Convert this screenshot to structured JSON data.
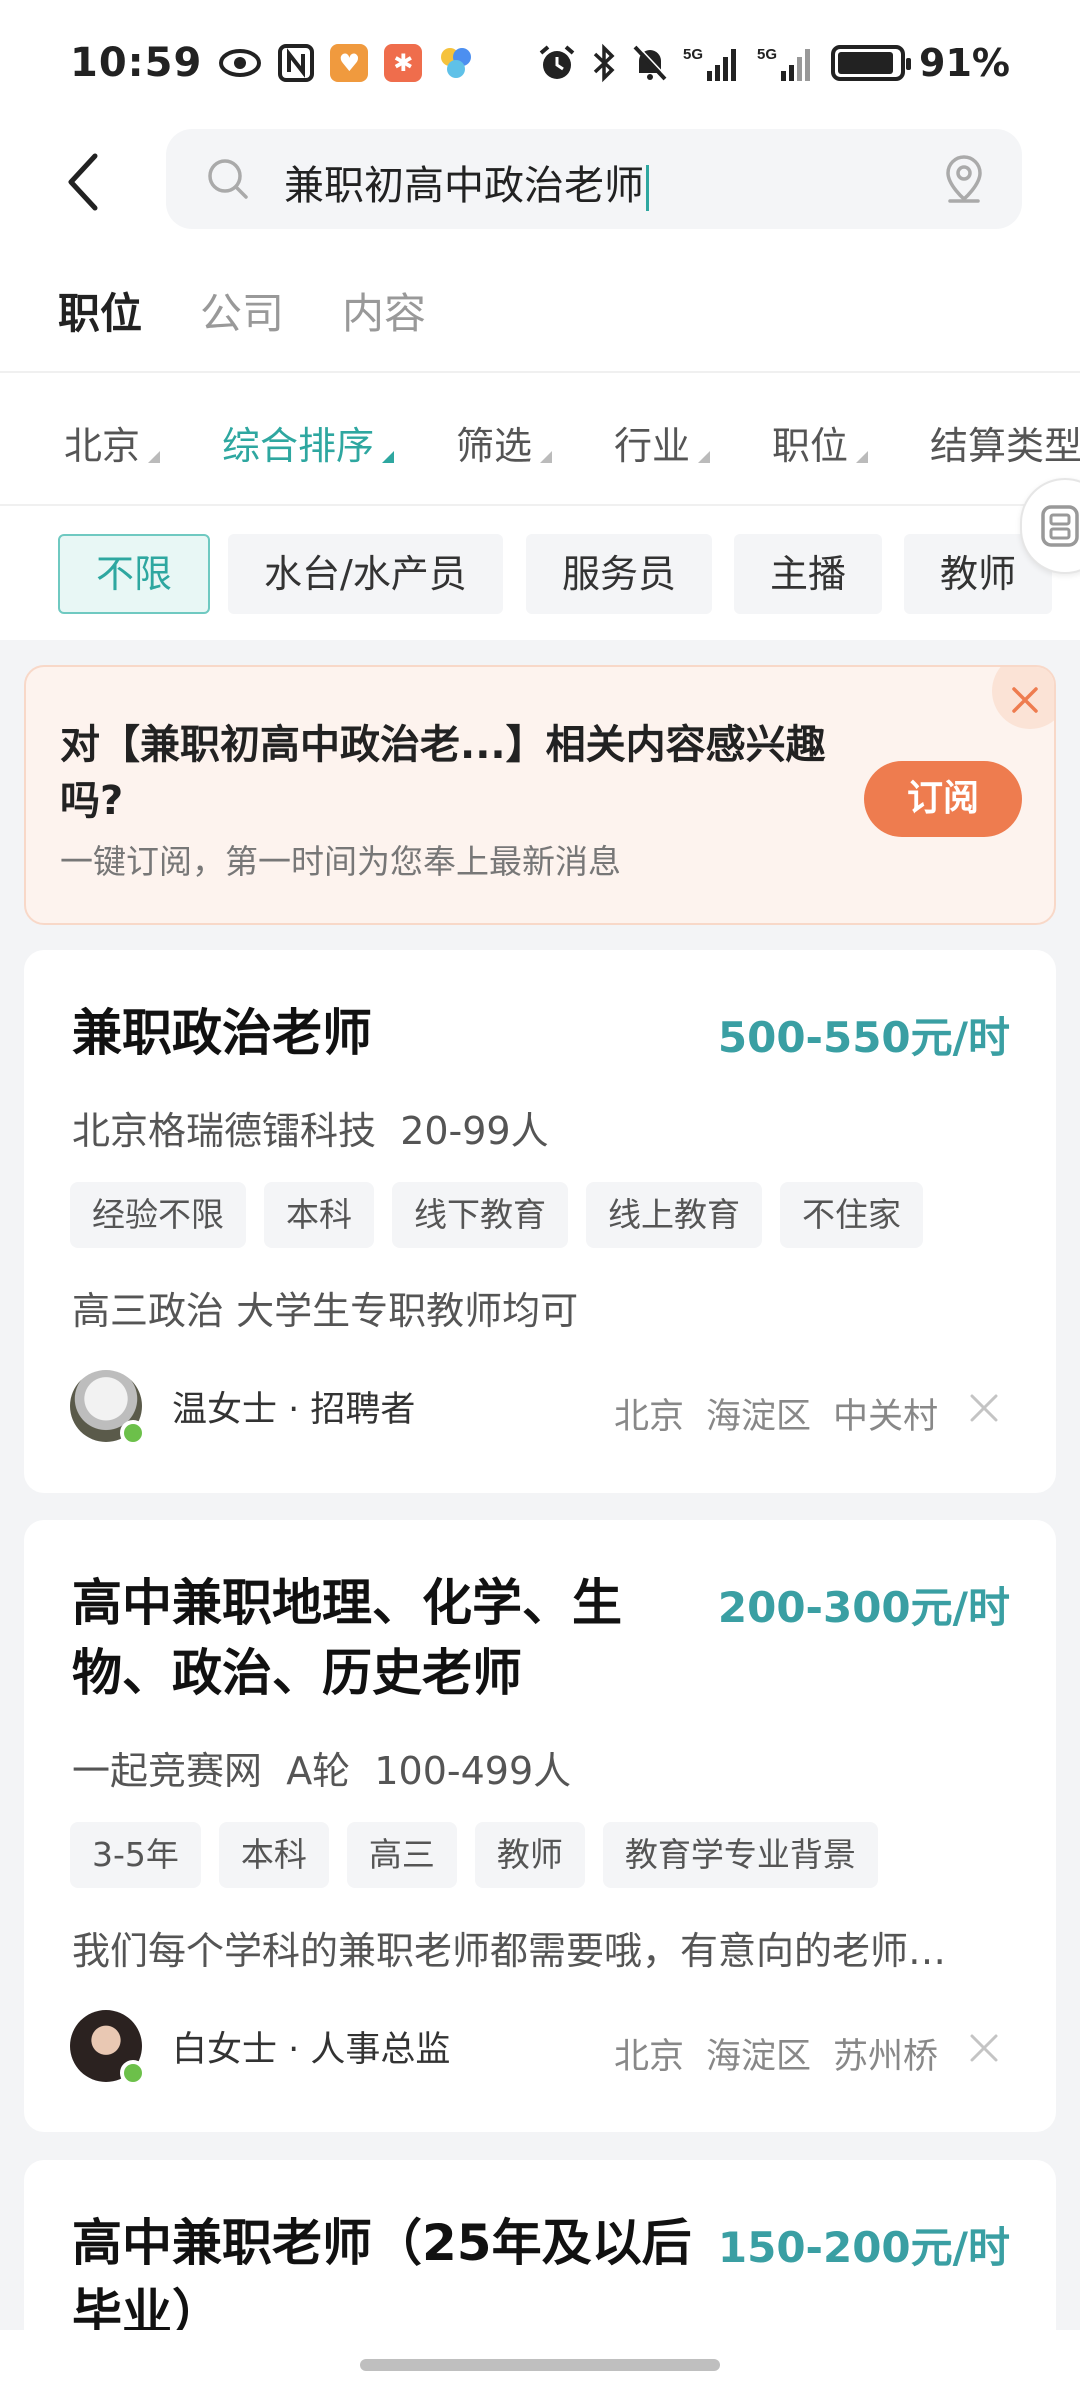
{
  "status_bar": {
    "time": "10:59",
    "left_icons": [
      "eye-icon",
      "nfc-icon",
      "app-heart-icon",
      "app-person-icon",
      "app-pinwheel-icon"
    ],
    "right_icons": [
      "alarm-icon",
      "bluetooth-icon",
      "mute-icon",
      "signal-5g-icon",
      "signal-5g-icon",
      "battery-icon"
    ],
    "battery": "91%",
    "battery_level": 0.91
  },
  "search": {
    "query": "兼职初高中政治老师",
    "accent_color": "#2ea7a0"
  },
  "tabs": [
    {
      "label": "职位",
      "active": true
    },
    {
      "label": "公司",
      "active": false
    },
    {
      "label": "内容",
      "active": false
    }
  ],
  "filters": [
    {
      "label": "北京",
      "active": false
    },
    {
      "label": "综合排序",
      "active": true
    },
    {
      "label": "筛选",
      "active": false
    },
    {
      "label": "行业",
      "active": false
    },
    {
      "label": "职位",
      "active": false
    },
    {
      "label": "结算类型",
      "active": false
    }
  ],
  "chips": [
    {
      "label": "不限",
      "active": true
    },
    {
      "label": "水台/水产员",
      "active": false
    },
    {
      "label": "服务员",
      "active": false
    },
    {
      "label": "主播",
      "active": false
    },
    {
      "label": "教师",
      "active": false
    }
  ],
  "subscribe": {
    "title": "对【兼职初高中政治老...】相关内容感兴趣吗?",
    "desc": "一键订阅，第一时间为您奉上最新消息",
    "button": "订阅",
    "button_color": "#ee7c4f"
  },
  "jobs": [
    {
      "title": "兼职政治老师",
      "salary": "500-550元/时",
      "company": "北京格瑞德镭科技",
      "size": "20-99人",
      "tags": [
        "经验不限",
        "本科",
        "线下教育",
        "线上教育",
        "不住家"
      ],
      "desc": "高三政治 大学生专职教师均可",
      "recruiter": "温女士 · 招聘者",
      "location": [
        "北京",
        "海淀区",
        "中关村"
      ]
    },
    {
      "title": "高中兼职地理、化学、生物、政治、历史老师",
      "salary": "200-300元/时",
      "company": "一起竞赛网",
      "stage": "A轮",
      "size": "100-499人",
      "tags": [
        "3-5年",
        "本科",
        "高三",
        "教师",
        "教育学专业背景"
      ],
      "desc": "我们每个学科的兼职老师都需要哦，有意向的老师…",
      "recruiter": "白女士 · 人事总监",
      "location": [
        "北京",
        "海淀区",
        "苏州桥"
      ]
    },
    {
      "title": "高中兼职老师（25年及以后毕业）",
      "salary": "150-200元/时"
    }
  ]
}
